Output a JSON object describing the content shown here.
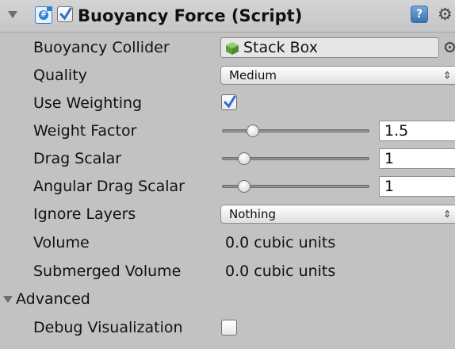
{
  "header": {
    "title": "Buoyancy Force (Script)",
    "enabled": true,
    "icons": {
      "foldout": "foldout-expanded-icon",
      "script": "csharp-script-icon",
      "help": "help-icon",
      "settings": "gear-icon"
    },
    "help_glyph": "?",
    "gear_glyph": "⚙"
  },
  "fields": {
    "buoyancy_collider": {
      "label": "Buoyancy Collider",
      "value": "Stack Box",
      "icon": "cube-icon"
    },
    "quality": {
      "label": "Quality",
      "value": "Medium",
      "arrows": "⇕"
    },
    "use_weighting": {
      "label": "Use Weighting",
      "checked": true
    },
    "weight_factor": {
      "label": "Weight Factor",
      "value": "1.5",
      "slider_fraction": 0.18
    },
    "drag_scalar": {
      "label": "Drag Scalar",
      "value": "1",
      "slider_fraction": 0.12
    },
    "angular_drag_scalar": {
      "label": "Angular Drag Scalar",
      "value": "1",
      "slider_fraction": 0.12
    },
    "ignore_layers": {
      "label": "Ignore Layers",
      "value": "Nothing",
      "arrows": "⇕"
    },
    "volume": {
      "label": "Volume",
      "value": "0.0 cubic units"
    },
    "submerged_volume": {
      "label": "Submerged Volume",
      "value": "0.0 cubic units"
    }
  },
  "advanced": {
    "label": "Advanced",
    "expanded": true,
    "debug_visualization": {
      "label": "Debug Visualization",
      "checked": false
    }
  },
  "colors": {
    "panel_bg": "#c2c2c2",
    "accent_blue": "#2f7fd0",
    "cube_green": "#6ab04c",
    "check_blue": "#2a6fd1"
  }
}
